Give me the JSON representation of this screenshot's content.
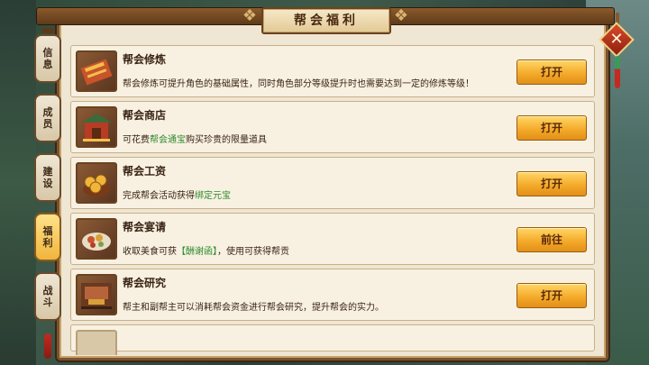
{
  "title": "帮会福利",
  "close_icon": "close-icon",
  "tabs": [
    {
      "label": "信\n息",
      "active": false
    },
    {
      "label": "成\n员",
      "active": false
    },
    {
      "label": "建\n设",
      "active": false
    },
    {
      "label": "福\n利",
      "active": true
    },
    {
      "label": "战\n斗",
      "active": false
    }
  ],
  "rows": [
    {
      "title": "帮会修炼",
      "desc_pre": "帮会修炼可提升角色的基础属性，同时角色部分等级提升时也需要达到一定的修炼等级！",
      "desc_hl": "",
      "desc_post": "",
      "button": "打开",
      "icon": "scroll-book-icon"
    },
    {
      "title": "帮会商店",
      "desc_pre": "可花费",
      "desc_hl": "帮会通宝",
      "desc_post": "购买珍贵的限量道具",
      "button": "打开",
      "icon": "shop-building-icon"
    },
    {
      "title": "帮会工资",
      "desc_pre": "完成帮会活动获得",
      "desc_hl": "绑定元宝",
      "desc_post": "",
      "button": "打开",
      "icon": "gold-coins-icon"
    },
    {
      "title": "帮会宴请",
      "desc_pre": "收取美食可获",
      "desc_hl": "【酬谢函】",
      "desc_post": "，使用可获得帮贡",
      "button": "前往",
      "icon": "banquet-dish-icon"
    },
    {
      "title": "帮会研究",
      "desc_pre": "帮主和副帮主可以消耗帮会资金进行帮会研究，提升帮会的实力。",
      "desc_hl": "",
      "desc_post": "",
      "button": "打开",
      "icon": "research-hall-icon"
    },
    {
      "title": "",
      "desc_pre": "",
      "desc_hl": "",
      "desc_post": "",
      "button": "",
      "icon": "partial-item-icon"
    }
  ]
}
